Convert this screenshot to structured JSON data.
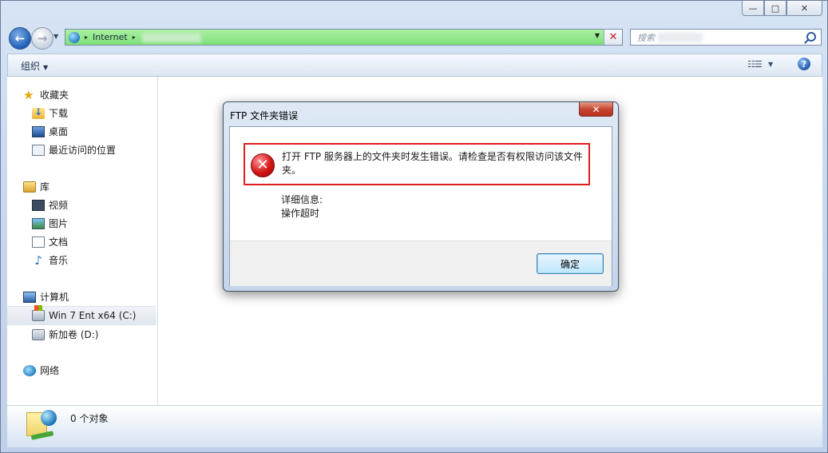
{
  "window": {
    "caption": {
      "minimize": "—",
      "maximize": "□",
      "close": "✕"
    }
  },
  "navigation": {
    "back": "←",
    "forward": "→",
    "address": {
      "segment": "Internet",
      "separator": "▸",
      "dropdown": "▼",
      "stop": "✕"
    },
    "search": {
      "placeholder": "搜索"
    }
  },
  "toolbar": {
    "organize": "组织",
    "organize_arrow": "▼",
    "view": "☷☰",
    "view_arrow": "▼",
    "help": "?"
  },
  "sidebar": {
    "favorites": {
      "label": "收藏夹",
      "items": [
        "下载",
        "桌面",
        "最近访问的位置"
      ]
    },
    "libraries": {
      "label": "库",
      "items": [
        "视频",
        "图片",
        "文档",
        "音乐"
      ]
    },
    "computer": {
      "label": "计算机",
      "drives": [
        "Win 7 Ent x64 (C:)",
        "新加卷 (D:)"
      ]
    },
    "network": {
      "label": "网络"
    }
  },
  "details_pane": {
    "item_count": "0 个对象"
  },
  "dialog": {
    "title": "FTP 文件夹错误",
    "close": "✕",
    "message": "打开 FTP 服务器上的文件夹时发生错误。请检查是否有权限访问该文件夹。",
    "details_label": "详细信息:",
    "details_value": "操作超时",
    "ok_button": "确定",
    "error_icon": "✕"
  },
  "colors": {
    "error_highlight": "#e21d1d",
    "accent": "#3c7fb1"
  }
}
